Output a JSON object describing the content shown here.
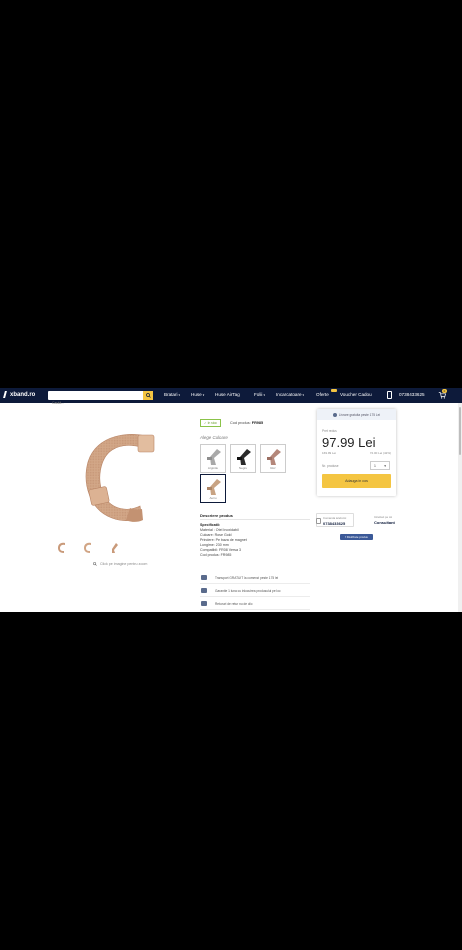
{
  "nav": {
    "logo": "xband.ro",
    "search_placeholder": "Caută...",
    "menu": [
      {
        "label": "Bratari"
      },
      {
        "label": "Huse"
      },
      {
        "label": "Huse AirTag"
      },
      {
        "label": "Folii"
      },
      {
        "label": "Incarcatoare"
      },
      {
        "label": "Oferte"
      },
      {
        "label": "Voucher Cadou"
      }
    ],
    "phone": "0738433625",
    "cart_count": "0"
  },
  "product": {
    "gallery_hint": "Click pe imagine pentru zoom",
    "stock": "In stoc",
    "code_label": "Cod produs:",
    "code": "FR985",
    "color_title": "Alege Culoare",
    "colors": [
      {
        "label": "Argintiu"
      },
      {
        "label": "Negru"
      },
      {
        "label": "Roz"
      },
      {
        "label": "Auriu"
      }
    ],
    "description_title": "Descriere produs",
    "specs": [
      "Specificatii:",
      "Material : Otel Inoxidabil",
      "Culoare: Rose Gold",
      "Prindere: Pe baza de magnet",
      "Lungime: 230 mm",
      "Compatibil: FR08 Versa 3",
      "Cod produs: FR985"
    ],
    "features": [
      "Transport GRATUIT la comenzi peste 175 lei",
      "Garantie 1 luna cu inlocuirea produsului pe loc",
      "Retururi de retur nu de clic"
    ]
  },
  "pricebox": {
    "shipping": "Livrare gratuita peste 175 Lei",
    "price_label": "Pret redus",
    "price": "97.99 Lei",
    "old_price": "169.99 Lei",
    "save": "72.00 Lei (42%)",
    "qty_label": "Nr. produse",
    "qty": "1",
    "add_to_cart": "Adauga in cos",
    "order_phone_title": "Comanda telefonic",
    "order_phone": "0738433625",
    "consult_title": "Intrebari pe tot",
    "consult": "Consultant",
    "fb": "Distribuie produs"
  },
  "colors": {
    "nav_bg": "#0d1a3a",
    "accent": "#f4c542",
    "band": "#d4a98a"
  }
}
